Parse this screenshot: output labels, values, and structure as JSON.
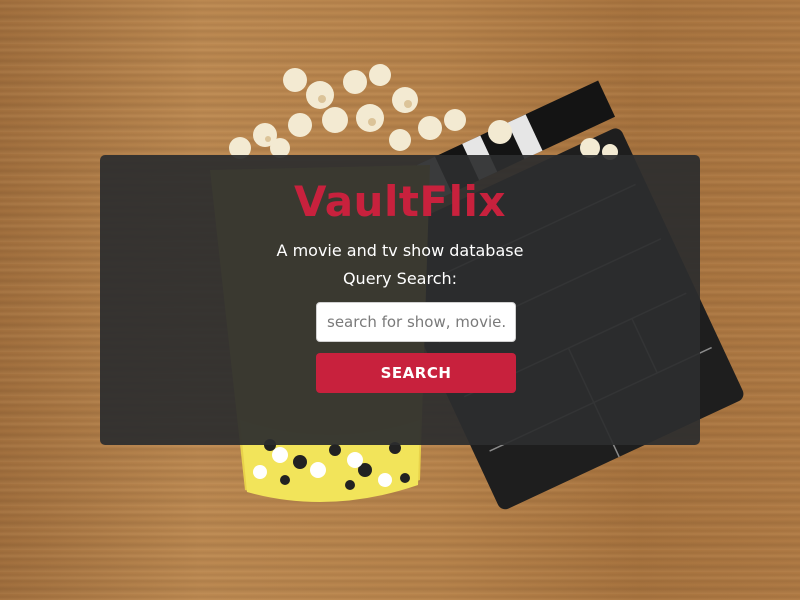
{
  "app": {
    "title": "VaultFlix",
    "subtitle": "A movie and tv show database",
    "accent_color": "#c8213d"
  },
  "search": {
    "label": "Query Search:",
    "placeholder": "search for show, movie..",
    "value": "",
    "button_label": "SEARCH"
  },
  "background": {
    "icons": [
      "popcorn-bucket-image",
      "clapperboard-image",
      "wood-table-image"
    ]
  }
}
